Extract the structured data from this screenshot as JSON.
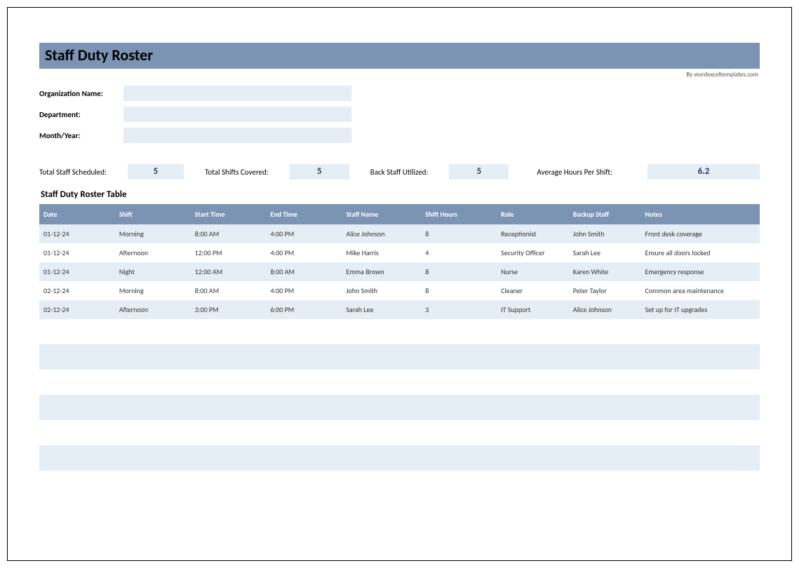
{
  "title": "Staff Duty Roster",
  "credit": "By wordexceltemplates.com",
  "fields": {
    "org_label": "Organization Name:",
    "org_value": "",
    "dept_label": "Department:",
    "dept_value": "",
    "month_label": "Month/Year:",
    "month_value": ""
  },
  "stats": {
    "total_staff_label": "Total Staff Scheduled:",
    "total_staff_value": "5",
    "total_shifts_label": "Total Shifts Covered:",
    "total_shifts_value": "5",
    "back_staff_label": "Back Staff Utilized:",
    "back_staff_value": "5",
    "avg_hours_label": "Average Hours Per Shift:",
    "avg_hours_value": "6.2"
  },
  "table_section_title": "Staff Duty Roster Table",
  "columns": [
    "Date",
    "Shift",
    "Start Time",
    "End Time",
    "Staff Name",
    "Shift Hours",
    "Role",
    "Backup Staff",
    "Notes"
  ],
  "rows": [
    {
      "date": "01-12-24",
      "shift": "Morning",
      "start": "8:00 AM",
      "end": "4:00 PM",
      "name": "Alice Johnson",
      "hours": "8",
      "role": "Receptionist",
      "backup": "John Smith",
      "notes": "Front desk coverage"
    },
    {
      "date": "01-12-24",
      "shift": "Afternoon",
      "start": "12:00 PM",
      "end": "4:00 PM",
      "name": "Mike Harris",
      "hours": "4",
      "role": "Security Officer",
      "backup": "Sarah Lee",
      "notes": "Ensure all doors locked"
    },
    {
      "date": "01-12-24",
      "shift": "Night",
      "start": "12:00 AM",
      "end": "8:00 AM",
      "name": "Emma Brown",
      "hours": "8",
      "role": "Nurse",
      "backup": "Karen White",
      "notes": "Emergency response"
    },
    {
      "date": "02-12-24",
      "shift": "Morning",
      "start": "8:00 AM",
      "end": "4:00 PM",
      "name": "John Smith",
      "hours": "8",
      "role": "Cleaner",
      "backup": "Peter Taylor",
      "notes": "Common area maintenance"
    },
    {
      "date": "02-12-24",
      "shift": "Afternoon",
      "start": "3:00 PM",
      "end": "6:00 PM",
      "name": "Sarah Lee",
      "hours": "3",
      "role": "IT Support",
      "backup": "Alice Johnson",
      "notes": "Set up for IT upgrades"
    }
  ],
  "blank_rows": 7
}
